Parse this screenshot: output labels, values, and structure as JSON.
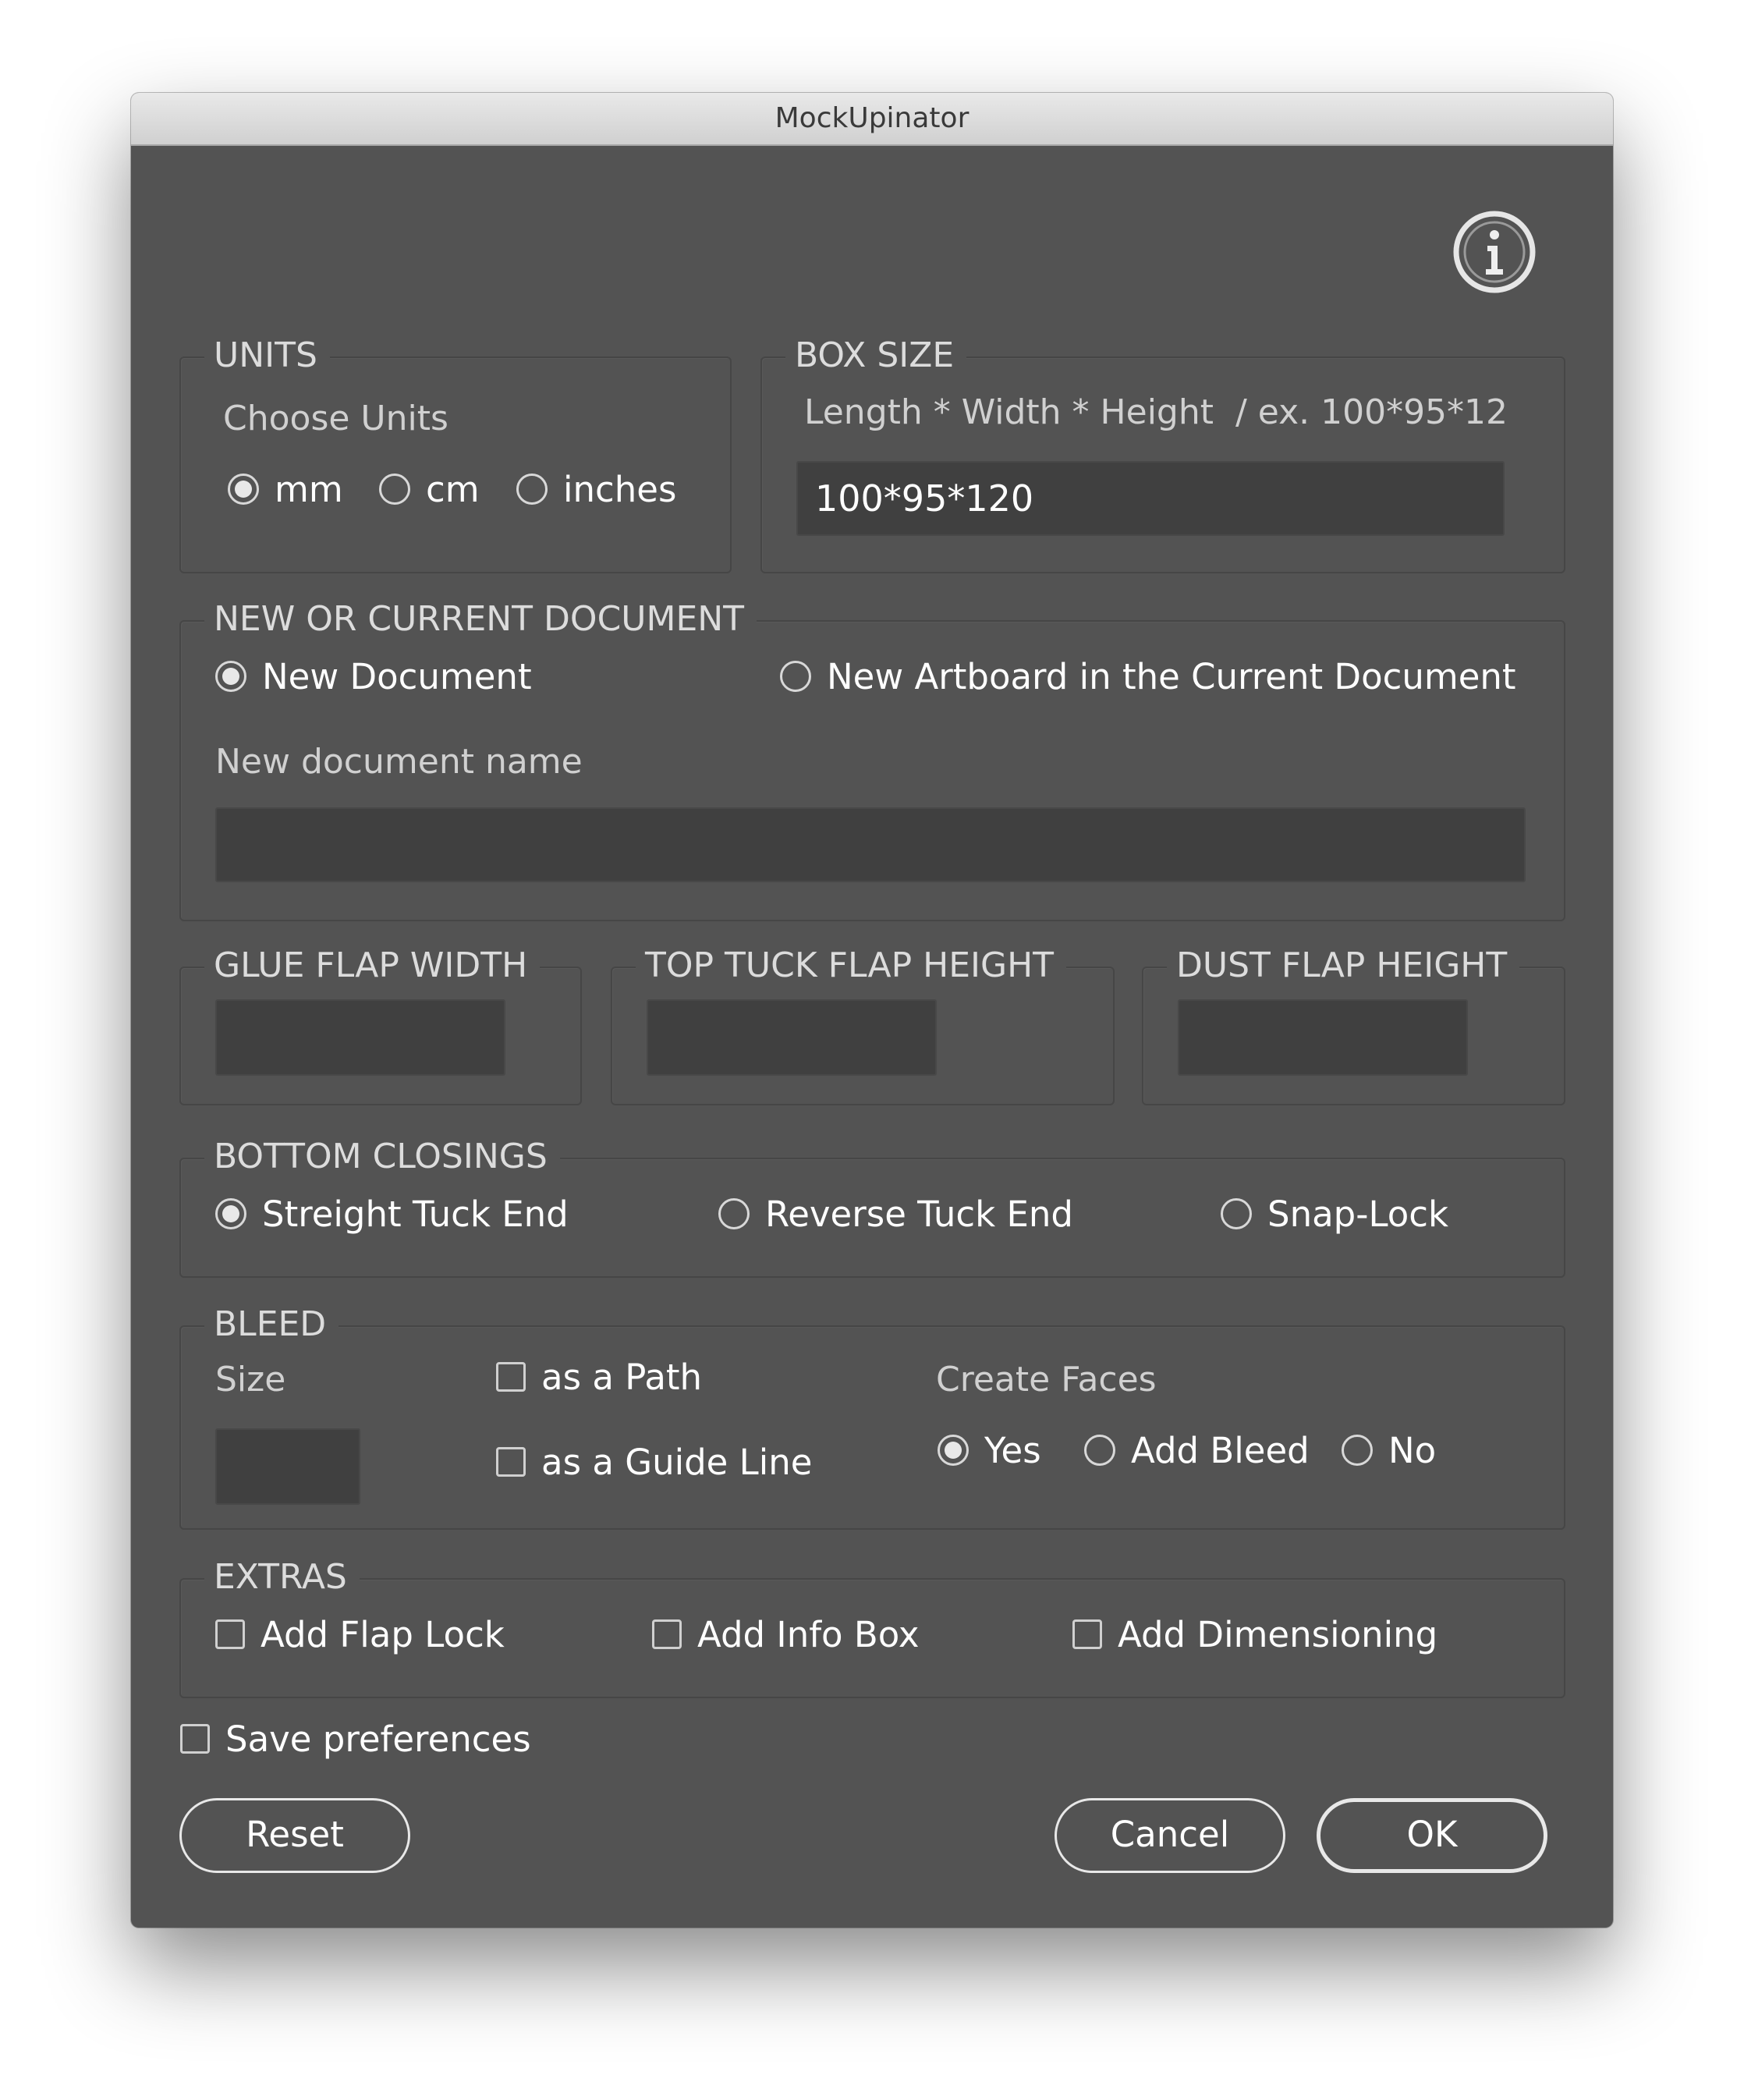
{
  "window": {
    "title": "MockUpinator"
  },
  "units": {
    "legend": "UNITS",
    "label": "Choose Units",
    "options": [
      {
        "label": "mm",
        "selected": true
      },
      {
        "label": "cm",
        "selected": false
      },
      {
        "label": "inches",
        "selected": false
      }
    ]
  },
  "box_size": {
    "legend": "BOX SIZE",
    "hint": "Length * Width * Height  / ex. 100*95*12",
    "value": "100*95*120"
  },
  "document": {
    "legend": "NEW OR CURRENT DOCUMENT",
    "options": [
      {
        "label": "New Document",
        "selected": true
      },
      {
        "label": "New Artboard in the Current Document",
        "selected": false
      }
    ],
    "name_label": "New document name",
    "name_value": ""
  },
  "flaps": {
    "glue": {
      "legend": "GLUE FLAP WIDTH",
      "value": ""
    },
    "top_tuck": {
      "legend": "TOP TUCK FLAP HEIGHT",
      "value": ""
    },
    "dust": {
      "legend": "DUST FLAP HEIGHT",
      "value": ""
    }
  },
  "bottom_closings": {
    "legend": "BOTTOM CLOSINGS",
    "options": [
      {
        "label": "Streight Tuck End",
        "selected": true
      },
      {
        "label": "Reverse Tuck End",
        "selected": false
      },
      {
        "label": "Snap-Lock",
        "selected": false
      }
    ]
  },
  "bleed": {
    "legend": "BLEED",
    "size_label": "Size",
    "size_value": "",
    "as_path": {
      "label": "as a Path",
      "checked": false
    },
    "as_guide": {
      "label": "as a Guide Line",
      "checked": false
    },
    "create_faces_label": "Create Faces",
    "faces_options": [
      {
        "label": "Yes",
        "selected": true
      },
      {
        "label": "Add Bleed",
        "selected": false
      },
      {
        "label": "No",
        "selected": false
      }
    ]
  },
  "extras": {
    "legend": "EXTRAS",
    "options": [
      {
        "label": "Add Flap Lock",
        "checked": false
      },
      {
        "label": "Add Info Box",
        "checked": false
      },
      {
        "label": "Add Dimensioning",
        "checked": false
      }
    ]
  },
  "save_preferences": {
    "label": "Save preferences",
    "checked": false
  },
  "buttons": {
    "reset": "Reset",
    "cancel": "Cancel",
    "ok": "OK"
  },
  "icons": {
    "info": "info-icon"
  }
}
